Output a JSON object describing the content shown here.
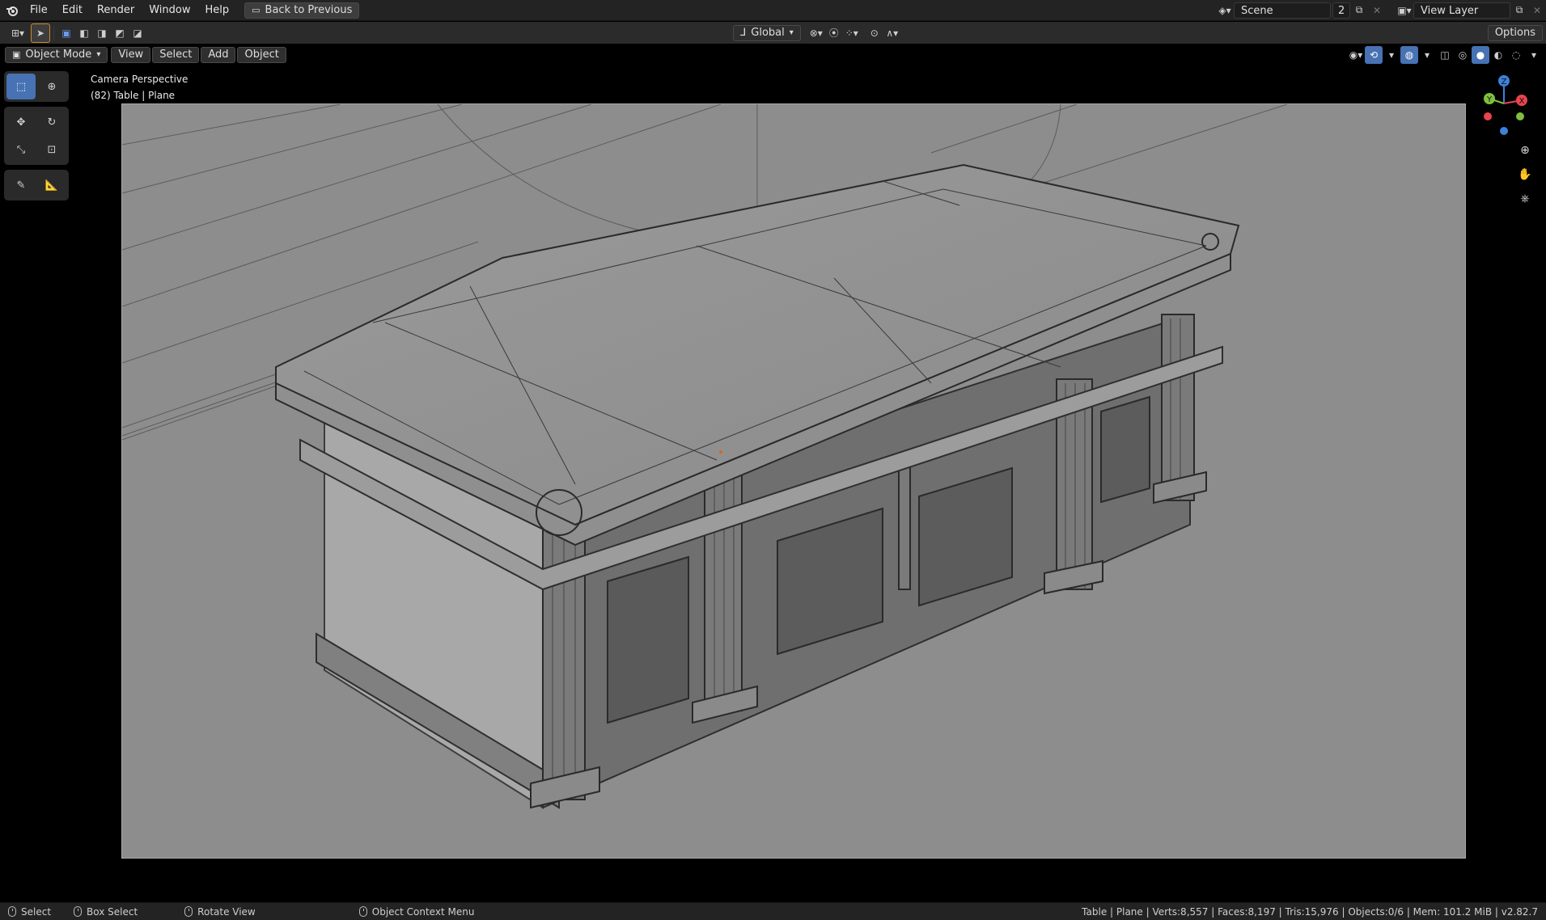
{
  "topbar": {
    "menus": [
      "File",
      "Edit",
      "Render",
      "Window",
      "Help"
    ],
    "back_label": "Back to Previous",
    "scene_name": "Scene",
    "scene_users": "2",
    "view_layer": "View Layer"
  },
  "tool_header": {
    "orientation": "Global",
    "options_label": "Options"
  },
  "view_header": {
    "mode": "Object Mode",
    "menus": [
      "View",
      "Select",
      "Add",
      "Object"
    ]
  },
  "viewport": {
    "perspective_label": "Camera Perspective",
    "object_label": "(82) Table | Plane"
  },
  "gizmo": {
    "z": "Z",
    "y": "Y",
    "x": "X"
  },
  "statusbar": {
    "select": "Select",
    "box_select": "Box Select",
    "rotate_view": "Rotate View",
    "context_menu": "Object Context Menu",
    "stats": "Table | Plane | Verts:8,557 | Faces:8,197 | Tris:15,976 | Objects:0/6 | Mem: 101.2 MiB | v2.82.7"
  },
  "colors": {
    "accent": "#4772b3",
    "axis_x": "#e8454f",
    "axis_y": "#7fbf3d",
    "axis_z": "#3b82d8"
  }
}
